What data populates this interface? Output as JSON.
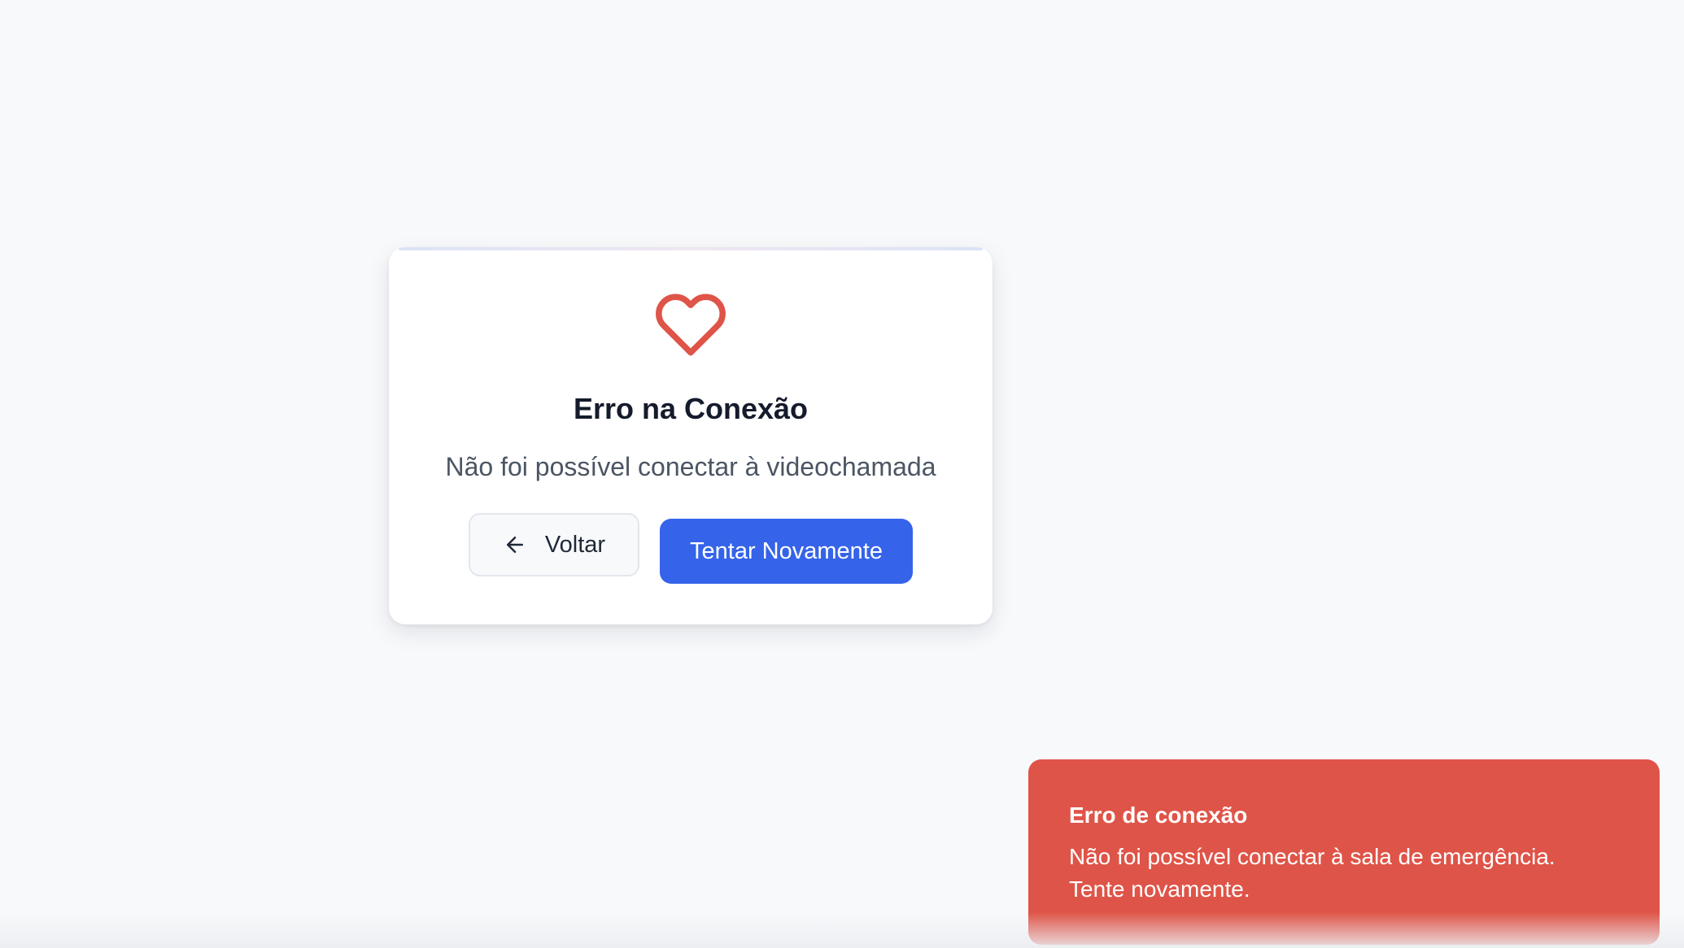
{
  "error_card": {
    "icon": "heart-icon",
    "icon_color": "#df5448",
    "title": "Erro na Conexão",
    "subtitle": "Não foi possível conectar à videochamada",
    "back_button": {
      "icon": "arrow-left-icon",
      "label": "Voltar"
    },
    "retry_button": {
      "label": "Tentar Novamente",
      "color": "#3563e9"
    }
  },
  "toast": {
    "title": "Erro de conexão",
    "message": "Não foi possível conectar à sala de emergência. Tente novamente.",
    "color": "#df5448"
  }
}
